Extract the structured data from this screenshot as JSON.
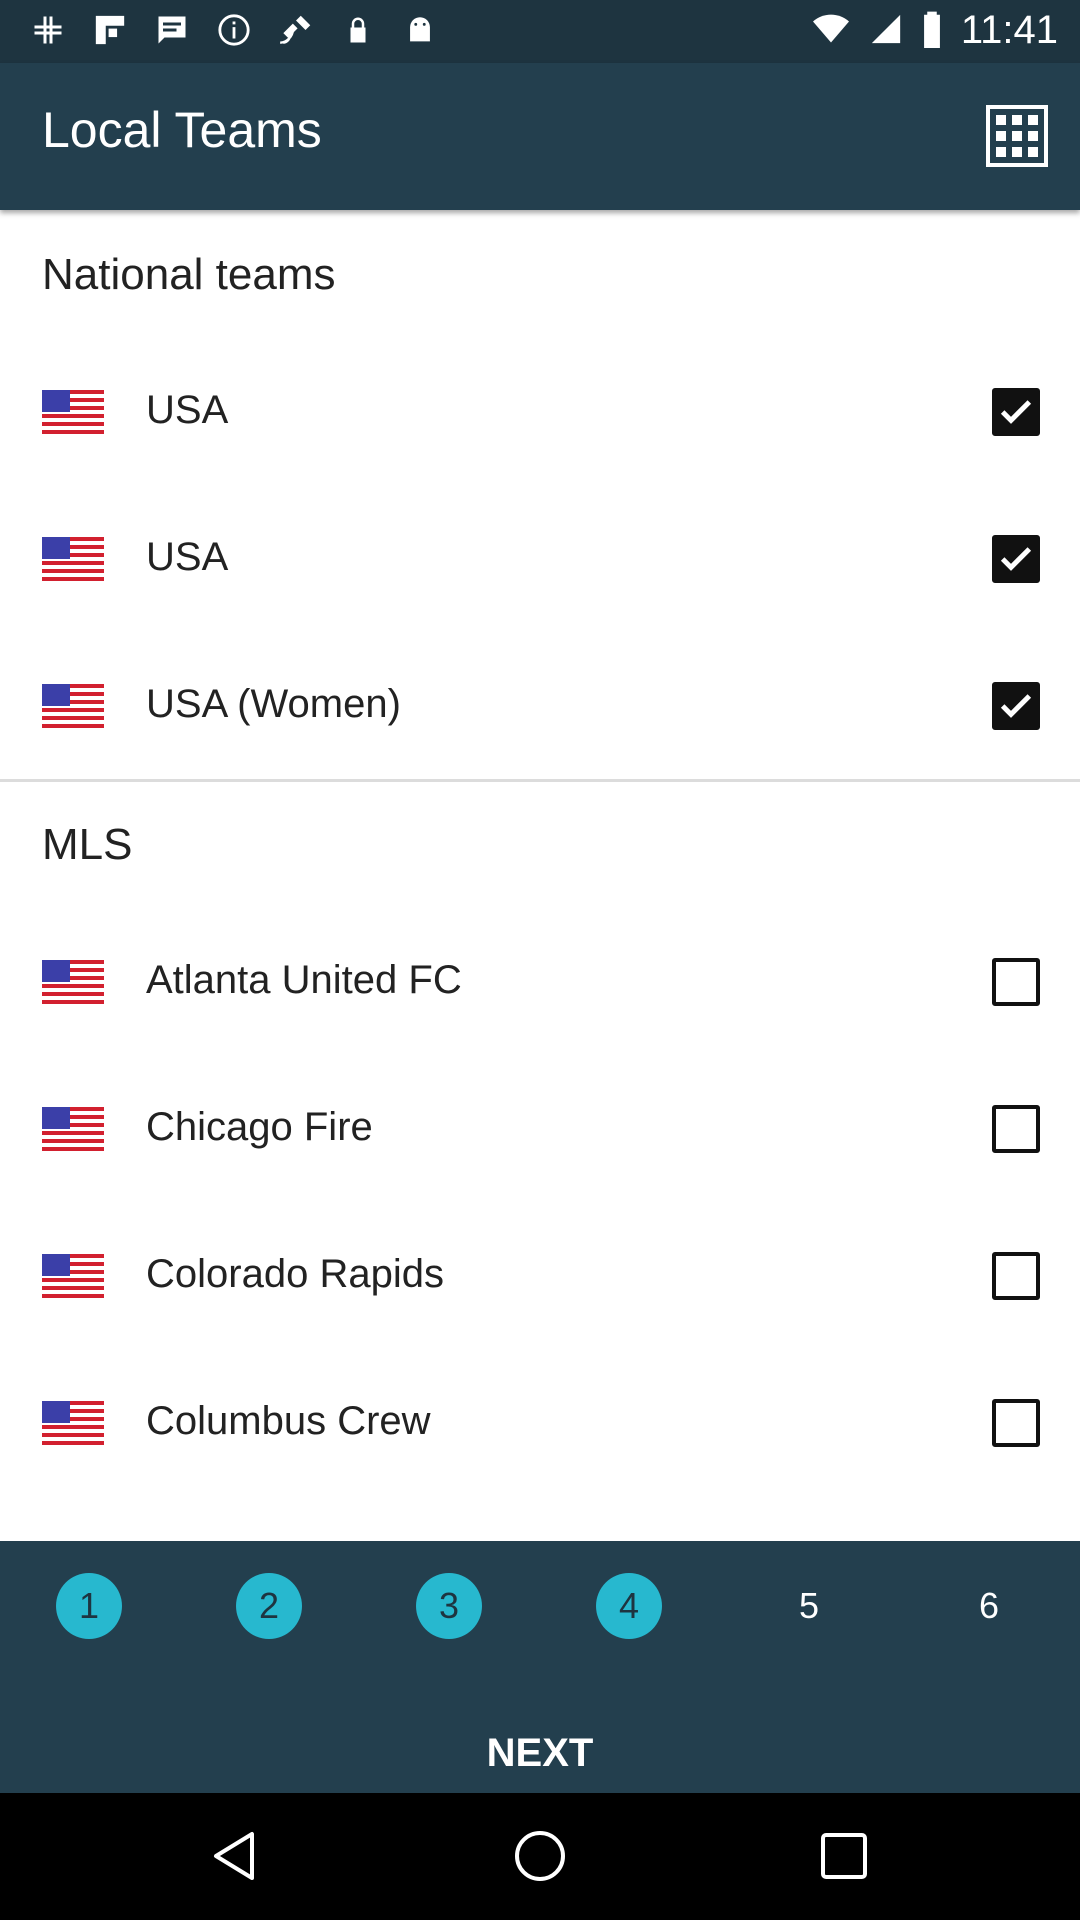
{
  "status_bar": {
    "time": "11:41",
    "left_icons": [
      "slack-icon",
      "flipboard-icon",
      "message-icon",
      "info-icon",
      "fake-gps-icon",
      "lock-icon",
      "android-icon"
    ],
    "right_icons": [
      "wifi-icon",
      "signal-icon",
      "battery-icon"
    ]
  },
  "app_bar": {
    "title": "Local Teams",
    "action_icon": "grid-view-icon"
  },
  "sections": [
    {
      "title": "National teams",
      "teams": [
        {
          "name": "USA",
          "checked": true
        },
        {
          "name": "USA",
          "checked": true
        },
        {
          "name": "USA (Women)",
          "checked": true
        }
      ]
    },
    {
      "title": "MLS",
      "teams": [
        {
          "name": "Atlanta United FC",
          "checked": false
        },
        {
          "name": "Chicago Fire",
          "checked": false
        },
        {
          "name": "Colorado Rapids",
          "checked": false
        },
        {
          "name": "Columbus Crew",
          "checked": false
        }
      ]
    }
  ],
  "pager": {
    "pages": [
      {
        "label": "1",
        "state": "active"
      },
      {
        "label": "2",
        "state": "active"
      },
      {
        "label": "3",
        "state": "active"
      },
      {
        "label": "4",
        "state": "active"
      },
      {
        "label": "5",
        "state": "inactive"
      },
      {
        "label": "6",
        "state": "inactive"
      }
    ],
    "next_label": "NEXT"
  },
  "nav_bar": {
    "icons": [
      "back-icon",
      "home-icon",
      "recents-icon"
    ]
  },
  "colors": {
    "status_bar": "#1e3440",
    "app_bar": "#233f4e",
    "accent": "#27b8cf",
    "text": "#222222"
  }
}
